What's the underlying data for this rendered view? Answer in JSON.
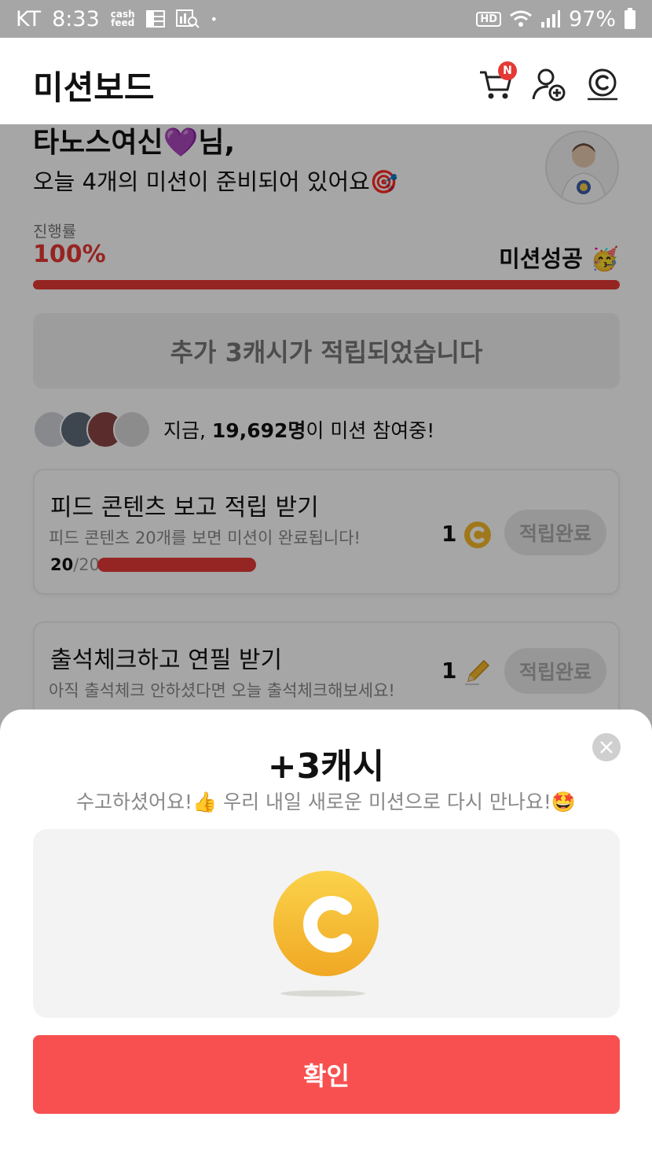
{
  "status_bar": {
    "carrier": "KT",
    "time": "8:33",
    "cashfeed_line1": "cash",
    "cashfeed_line2": "feed",
    "dot": "•",
    "hd": "HD",
    "battery": "97%"
  },
  "header": {
    "title": "미션보드",
    "cart_badge": "N"
  },
  "greeting": {
    "name": "타노스여신💜님,",
    "subtitle": "오늘 4개의 미션이 준비되어 있어요🎯"
  },
  "progress": {
    "label": "진행률",
    "percent_text": "100%",
    "value": 1.0,
    "success_label": "미션성공 🥳"
  },
  "bonus": {
    "text": "추가 3캐시가 적립되었습니다"
  },
  "participants": {
    "prefix": "지금,",
    "count": "19,692명",
    "suffix": "이 미션 참여중!"
  },
  "missions": [
    {
      "title": "피드 콘텐츠 보고 적립 받기",
      "desc": "피드 콘텐츠 20개를 보면 미션이 완료됩니다!",
      "progress_done": "20",
      "progress_total": "/20",
      "progress_value": 1.0,
      "reward_amount": "1",
      "reward_icon": "coin-icon",
      "button_label": "적립완료"
    },
    {
      "title": "출석체크하고 연필 받기",
      "desc": "아직 출석체크 안하셨다면 오늘 출석체크해보세요!",
      "reward_amount": "1",
      "reward_icon": "pencil-icon",
      "button_label": "적립완료"
    }
  ],
  "sheet": {
    "title": "+3캐시",
    "message": "수고하셨어요!👍 우리 내일 새로운 미션으로 다시 만나요!🤩",
    "confirm_label": "확인"
  },
  "colors": {
    "accent_red": "#e53935",
    "confirm_red": "#f85050",
    "coin_gold": "#f5b92a"
  }
}
